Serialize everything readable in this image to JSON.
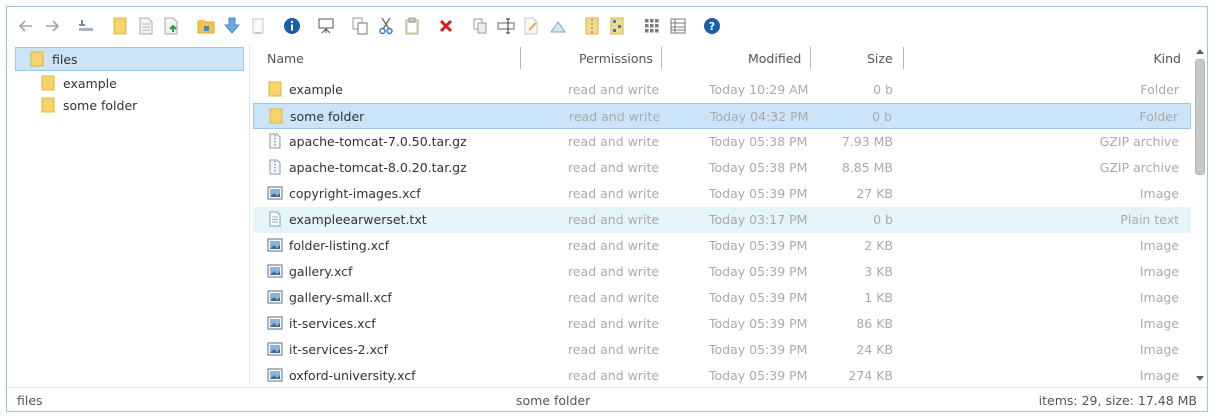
{
  "toolbar": {
    "buttons": [
      {
        "name": "back-icon",
        "color": "#9aa7b3"
      },
      {
        "name": "forward-icon",
        "color": "#9aa7b3"
      },
      {
        "name": "up-level-icon",
        "color": "#8fa0b2"
      },
      {
        "name": "new-folder-icon",
        "color": "#f5c94a"
      },
      {
        "name": "new-file-icon",
        "color": "#cfcfcf"
      },
      {
        "name": "upload-icon",
        "color": "#3aa655"
      },
      {
        "name": "folder-home-icon",
        "color": "#e9b83b"
      },
      {
        "name": "download-icon",
        "color": "#5b9bd5"
      },
      {
        "name": "clipboard-empty-icon",
        "color": "#d0d0d0"
      },
      {
        "name": "info-icon",
        "color": "#1a5ea8"
      },
      {
        "name": "preview-icon",
        "color": "#555555"
      },
      {
        "name": "copy-icon",
        "color": "#8a8a8a"
      },
      {
        "name": "cut-icon",
        "color": "#3b7cc0"
      },
      {
        "name": "paste-icon",
        "color": "#b5a887"
      },
      {
        "name": "delete-icon",
        "color": "#d32020"
      },
      {
        "name": "duplicate-icon",
        "color": "#9a9a9a"
      },
      {
        "name": "rename-icon",
        "color": "#5a6b7a"
      },
      {
        "name": "edit-icon",
        "color": "#c9c9c9"
      },
      {
        "name": "resize-icon",
        "color": "#7aa6c2"
      },
      {
        "name": "archive-icon",
        "color": "#e3c15d"
      },
      {
        "name": "extract-icon",
        "color": "#e3c15d"
      },
      {
        "name": "thumbnails-view-icon",
        "color": "#7a7a7a"
      },
      {
        "name": "list-view-icon",
        "color": "#7a7a7a"
      },
      {
        "name": "help-icon",
        "color": "#1a5ea8"
      }
    ]
  },
  "tree": {
    "items": [
      {
        "label": "files",
        "level": 0,
        "selected": true
      },
      {
        "label": "example",
        "level": 1,
        "selected": false
      },
      {
        "label": "some folder",
        "level": 1,
        "selected": false
      }
    ]
  },
  "columns": {
    "name": "Name",
    "permissions": "Permissions",
    "modified": "Modified",
    "size": "Size",
    "kind": "Kind"
  },
  "files": [
    {
      "name": "example",
      "perm": "read and write",
      "modified": "Today 10:29 AM",
      "size": "0 b",
      "kind": "Folder",
      "icon": "folder-icon",
      "state": ""
    },
    {
      "name": "some folder",
      "perm": "read and write",
      "modified": "Today 04:32 PM",
      "size": "0 b",
      "kind": "Folder",
      "icon": "folder-icon",
      "state": "selected"
    },
    {
      "name": "apache-tomcat-7.0.50.tar.gz",
      "perm": "read and write",
      "modified": "Today 05:38 PM",
      "size": "7.93 MB",
      "kind": "GZIP archive",
      "icon": "archive-file-icon",
      "state": ""
    },
    {
      "name": "apache-tomcat-8.0.20.tar.gz",
      "perm": "read and write",
      "modified": "Today 05:38 PM",
      "size": "8.85 MB",
      "kind": "GZIP archive",
      "icon": "archive-file-icon",
      "state": ""
    },
    {
      "name": "copyright-images.xcf",
      "perm": "read and write",
      "modified": "Today 05:39 PM",
      "size": "27 KB",
      "kind": "Image",
      "icon": "image-file-icon",
      "state": ""
    },
    {
      "name": "exampleearwerset.txt",
      "perm": "read and write",
      "modified": "Today 03:17 PM",
      "size": "0 b",
      "kind": "Plain text",
      "icon": "text-file-icon",
      "state": "hover"
    },
    {
      "name": "folder-listing.xcf",
      "perm": "read and write",
      "modified": "Today 05:39 PM",
      "size": "2 KB",
      "kind": "Image",
      "icon": "image-file-icon",
      "state": ""
    },
    {
      "name": "gallery.xcf",
      "perm": "read and write",
      "modified": "Today 05:39 PM",
      "size": "3 KB",
      "kind": "Image",
      "icon": "image-file-icon",
      "state": ""
    },
    {
      "name": "gallery-small.xcf",
      "perm": "read and write",
      "modified": "Today 05:39 PM",
      "size": "1 KB",
      "kind": "Image",
      "icon": "image-file-icon",
      "state": ""
    },
    {
      "name": "it-services.xcf",
      "perm": "read and write",
      "modified": "Today 05:39 PM",
      "size": "86 KB",
      "kind": "Image",
      "icon": "image-file-icon",
      "state": ""
    },
    {
      "name": "it-services-2.xcf",
      "perm": "read and write",
      "modified": "Today 05:39 PM",
      "size": "24 KB",
      "kind": "Image",
      "icon": "image-file-icon",
      "state": ""
    },
    {
      "name": "oxford-university.xcf",
      "perm": "read and write",
      "modified": "Today 05:39 PM",
      "size": "274 KB",
      "kind": "Image",
      "icon": "image-file-icon",
      "state": ""
    }
  ],
  "status": {
    "path": "files",
    "selection": "some folder",
    "summary": "items: 29, size: 17.48 MB"
  }
}
